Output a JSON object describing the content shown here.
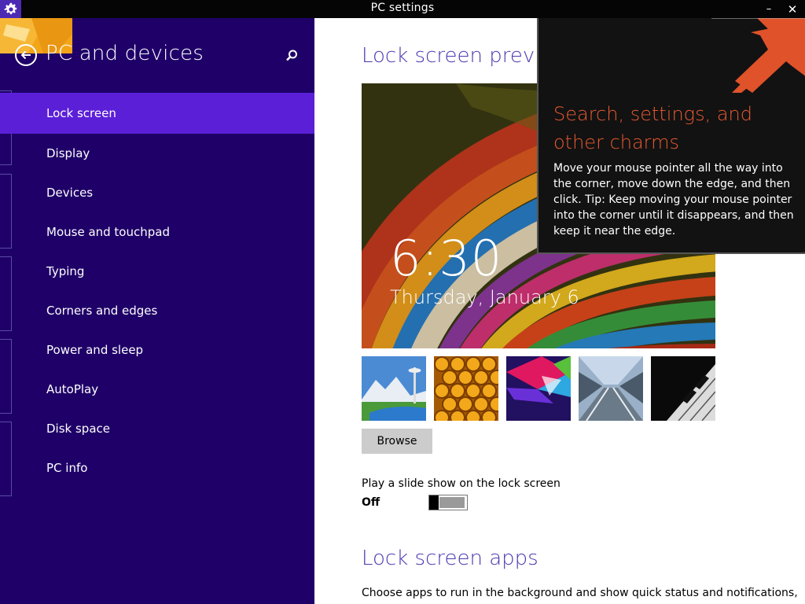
{
  "window": {
    "title": "PC settings",
    "minimize_glyph": "–",
    "close_glyph": "✕",
    "icon": "gear-icon"
  },
  "sidebar": {
    "title": "PC and devices",
    "back_icon": "back-arrow-icon",
    "search_icon": "search-icon",
    "items": [
      {
        "label": "Lock screen",
        "selected": true
      },
      {
        "label": "Display"
      },
      {
        "label": "Devices"
      },
      {
        "label": "Mouse and touchpad"
      },
      {
        "label": "Typing"
      },
      {
        "label": "Corners and edges"
      },
      {
        "label": "Power and sleep"
      },
      {
        "label": "AutoPlay"
      },
      {
        "label": "Disk space"
      },
      {
        "label": "PC info"
      }
    ]
  },
  "main": {
    "preview_title": "Lock screen preview",
    "preview_time": "6:30",
    "preview_date": "Thursday, January 6",
    "browse_label": "Browse",
    "slideshow_label": "Play a slide show on the lock screen",
    "slideshow_state": "Off",
    "apps_title": "Lock screen apps",
    "apps_desc": "Choose apps to run in the background and show quick status and notifications,"
  },
  "charms_tip": {
    "heading": "Search, settings, and other charms",
    "body": "Move your mouse pointer all the way into the corner, move down the edge, and then click. Tip: Keep moving your mouse pointer into the corner until it disappears, and then keep it near the edge."
  },
  "colors": {
    "sidebar_bg": "#1f0068",
    "selected_bg": "#5b1fd8",
    "accent_title": "#4a3ab0",
    "tip_heading": "#e85a30",
    "tip_arrow": "#e0522a"
  }
}
